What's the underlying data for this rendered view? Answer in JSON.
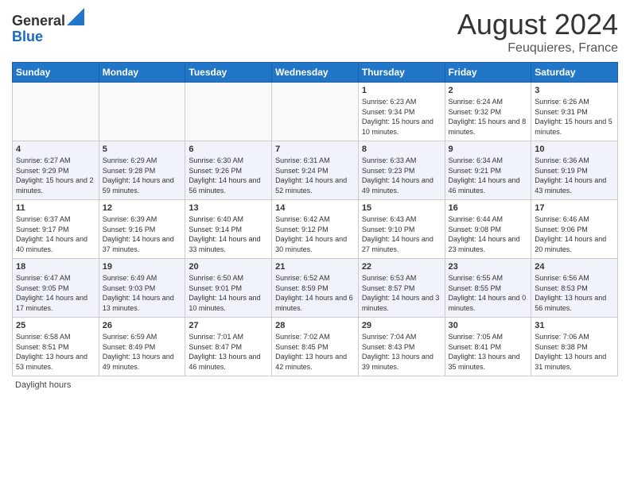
{
  "header": {
    "logo_general": "General",
    "logo_blue": "Blue",
    "month_year": "August 2024",
    "location": "Feuquieres, France"
  },
  "days_of_week": [
    "Sunday",
    "Monday",
    "Tuesday",
    "Wednesday",
    "Thursday",
    "Friday",
    "Saturday"
  ],
  "weeks": [
    [
      {
        "day": "",
        "sunrise": "",
        "sunset": "",
        "daylight": ""
      },
      {
        "day": "",
        "sunrise": "",
        "sunset": "",
        "daylight": ""
      },
      {
        "day": "",
        "sunrise": "",
        "sunset": "",
        "daylight": ""
      },
      {
        "day": "",
        "sunrise": "",
        "sunset": "",
        "daylight": ""
      },
      {
        "day": "1",
        "sunrise": "Sunrise: 6:23 AM",
        "sunset": "Sunset: 9:34 PM",
        "daylight": "Daylight: 15 hours and 10 minutes."
      },
      {
        "day": "2",
        "sunrise": "Sunrise: 6:24 AM",
        "sunset": "Sunset: 9:32 PM",
        "daylight": "Daylight: 15 hours and 8 minutes."
      },
      {
        "day": "3",
        "sunrise": "Sunrise: 6:26 AM",
        "sunset": "Sunset: 9:31 PM",
        "daylight": "Daylight: 15 hours and 5 minutes."
      }
    ],
    [
      {
        "day": "4",
        "sunrise": "Sunrise: 6:27 AM",
        "sunset": "Sunset: 9:29 PM",
        "daylight": "Daylight: 15 hours and 2 minutes."
      },
      {
        "day": "5",
        "sunrise": "Sunrise: 6:29 AM",
        "sunset": "Sunset: 9:28 PM",
        "daylight": "Daylight: 14 hours and 59 minutes."
      },
      {
        "day": "6",
        "sunrise": "Sunrise: 6:30 AM",
        "sunset": "Sunset: 9:26 PM",
        "daylight": "Daylight: 14 hours and 56 minutes."
      },
      {
        "day": "7",
        "sunrise": "Sunrise: 6:31 AM",
        "sunset": "Sunset: 9:24 PM",
        "daylight": "Daylight: 14 hours and 52 minutes."
      },
      {
        "day": "8",
        "sunrise": "Sunrise: 6:33 AM",
        "sunset": "Sunset: 9:23 PM",
        "daylight": "Daylight: 14 hours and 49 minutes."
      },
      {
        "day": "9",
        "sunrise": "Sunrise: 6:34 AM",
        "sunset": "Sunset: 9:21 PM",
        "daylight": "Daylight: 14 hours and 46 minutes."
      },
      {
        "day": "10",
        "sunrise": "Sunrise: 6:36 AM",
        "sunset": "Sunset: 9:19 PM",
        "daylight": "Daylight: 14 hours and 43 minutes."
      }
    ],
    [
      {
        "day": "11",
        "sunrise": "Sunrise: 6:37 AM",
        "sunset": "Sunset: 9:17 PM",
        "daylight": "Daylight: 14 hours and 40 minutes."
      },
      {
        "day": "12",
        "sunrise": "Sunrise: 6:39 AM",
        "sunset": "Sunset: 9:16 PM",
        "daylight": "Daylight: 14 hours and 37 minutes."
      },
      {
        "day": "13",
        "sunrise": "Sunrise: 6:40 AM",
        "sunset": "Sunset: 9:14 PM",
        "daylight": "Daylight: 14 hours and 33 minutes."
      },
      {
        "day": "14",
        "sunrise": "Sunrise: 6:42 AM",
        "sunset": "Sunset: 9:12 PM",
        "daylight": "Daylight: 14 hours and 30 minutes."
      },
      {
        "day": "15",
        "sunrise": "Sunrise: 6:43 AM",
        "sunset": "Sunset: 9:10 PM",
        "daylight": "Daylight: 14 hours and 27 minutes."
      },
      {
        "day": "16",
        "sunrise": "Sunrise: 6:44 AM",
        "sunset": "Sunset: 9:08 PM",
        "daylight": "Daylight: 14 hours and 23 minutes."
      },
      {
        "day": "17",
        "sunrise": "Sunrise: 6:46 AM",
        "sunset": "Sunset: 9:06 PM",
        "daylight": "Daylight: 14 hours and 20 minutes."
      }
    ],
    [
      {
        "day": "18",
        "sunrise": "Sunrise: 6:47 AM",
        "sunset": "Sunset: 9:05 PM",
        "daylight": "Daylight: 14 hours and 17 minutes."
      },
      {
        "day": "19",
        "sunrise": "Sunrise: 6:49 AM",
        "sunset": "Sunset: 9:03 PM",
        "daylight": "Daylight: 14 hours and 13 minutes."
      },
      {
        "day": "20",
        "sunrise": "Sunrise: 6:50 AM",
        "sunset": "Sunset: 9:01 PM",
        "daylight": "Daylight: 14 hours and 10 minutes."
      },
      {
        "day": "21",
        "sunrise": "Sunrise: 6:52 AM",
        "sunset": "Sunset: 8:59 PM",
        "daylight": "Daylight: 14 hours and 6 minutes."
      },
      {
        "day": "22",
        "sunrise": "Sunrise: 6:53 AM",
        "sunset": "Sunset: 8:57 PM",
        "daylight": "Daylight: 14 hours and 3 minutes."
      },
      {
        "day": "23",
        "sunrise": "Sunrise: 6:55 AM",
        "sunset": "Sunset: 8:55 PM",
        "daylight": "Daylight: 14 hours and 0 minutes."
      },
      {
        "day": "24",
        "sunrise": "Sunrise: 6:56 AM",
        "sunset": "Sunset: 8:53 PM",
        "daylight": "Daylight: 13 hours and 56 minutes."
      }
    ],
    [
      {
        "day": "25",
        "sunrise": "Sunrise: 6:58 AM",
        "sunset": "Sunset: 8:51 PM",
        "daylight": "Daylight: 13 hours and 53 minutes."
      },
      {
        "day": "26",
        "sunrise": "Sunrise: 6:59 AM",
        "sunset": "Sunset: 8:49 PM",
        "daylight": "Daylight: 13 hours and 49 minutes."
      },
      {
        "day": "27",
        "sunrise": "Sunrise: 7:01 AM",
        "sunset": "Sunset: 8:47 PM",
        "daylight": "Daylight: 13 hours and 46 minutes."
      },
      {
        "day": "28",
        "sunrise": "Sunrise: 7:02 AM",
        "sunset": "Sunset: 8:45 PM",
        "daylight": "Daylight: 13 hours and 42 minutes."
      },
      {
        "day": "29",
        "sunrise": "Sunrise: 7:04 AM",
        "sunset": "Sunset: 8:43 PM",
        "daylight": "Daylight: 13 hours and 39 minutes."
      },
      {
        "day": "30",
        "sunrise": "Sunrise: 7:05 AM",
        "sunset": "Sunset: 8:41 PM",
        "daylight": "Daylight: 13 hours and 35 minutes."
      },
      {
        "day": "31",
        "sunrise": "Sunrise: 7:06 AM",
        "sunset": "Sunset: 8:38 PM",
        "daylight": "Daylight: 13 hours and 31 minutes."
      }
    ]
  ],
  "footer": {
    "note": "Daylight hours"
  }
}
